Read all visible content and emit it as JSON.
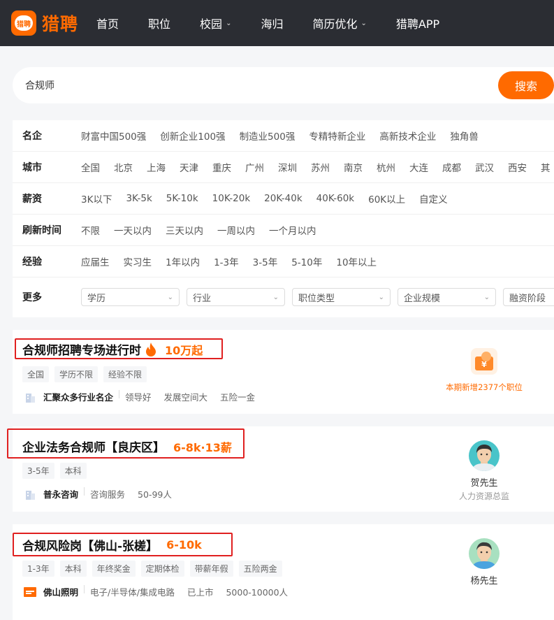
{
  "nav": {
    "logo_text": "猎聘",
    "logo_badge": "猎聘",
    "items": [
      {
        "label": "首页",
        "dropdown": false
      },
      {
        "label": "职位",
        "dropdown": false
      },
      {
        "label": "校园",
        "dropdown": true
      },
      {
        "label": "海归",
        "dropdown": false
      },
      {
        "label": "简历优化",
        "dropdown": true
      },
      {
        "label": "猎聘APP",
        "dropdown": false
      }
    ],
    "dropdown_icon": "chevron-down-icon"
  },
  "search": {
    "value": "合规师",
    "button_label": "搜索"
  },
  "filters": {
    "rows": [
      {
        "label": "名企",
        "options": [
          "财富中国500强",
          "创新企业100强",
          "制造业500强",
          "专精特新企业",
          "高新技术企业",
          "独角兽"
        ]
      },
      {
        "label": "城市",
        "options": [
          "全国",
          "北京",
          "上海",
          "天津",
          "重庆",
          "广州",
          "深圳",
          "苏州",
          "南京",
          "杭州",
          "大连",
          "成都",
          "武汉",
          "西安",
          "其"
        ]
      },
      {
        "label": "薪资",
        "options": [
          "3K以下",
          "3K-5k",
          "5K-10k",
          "10K-20k",
          "20K-40k",
          "40K-60k",
          "60K以上",
          "自定义"
        ]
      },
      {
        "label": "刷新时间",
        "options": [
          "不限",
          "一天以内",
          "三天以内",
          "一周以内",
          "一个月以内"
        ]
      },
      {
        "label": "经验",
        "options": [
          "应届生",
          "实习生",
          "1年以内",
          "1-3年",
          "3-5年",
          "5-10年",
          "10年以上"
        ]
      }
    ],
    "more": {
      "label": "更多",
      "selects": [
        "学历",
        "行业",
        "职位类型",
        "企业规模",
        "融资阶段"
      ]
    }
  },
  "jobs": [
    {
      "title": "合规师招聘专场进行时",
      "salary": "10万起",
      "has_flame": true,
      "tags": [
        "全国",
        "学历不限",
        "经验不限"
      ],
      "company": "汇聚众多行业名企",
      "info": [
        "领导好",
        "发展空间大",
        "五险一金"
      ],
      "promo": "本期新增2377个职位"
    },
    {
      "title": "企业法务合规师【良庆区】",
      "salary": "6-8k·13薪",
      "tags": [
        "3-5年",
        "本科"
      ],
      "company": "普永咨询",
      "info": [
        "咨询服务",
        "50-99人"
      ],
      "recruiter_name": "贺先生",
      "recruiter_title": "人力资源总监"
    },
    {
      "title": "合规风险岗【佛山-张槎】",
      "salary": "6-10k",
      "tags": [
        "1-3年",
        "本科",
        "年终奖金",
        "定期体检",
        "带薪年假",
        "五险两金"
      ],
      "company": "佛山照明",
      "info": [
        "电子/半导体/集成电路",
        "已上市",
        "5000-10000人"
      ],
      "recruiter_name": "杨先生"
    }
  ],
  "colors": {
    "accent": "#ff6a00",
    "nav_bg": "#2b2d33",
    "highlight": "#e02020"
  }
}
